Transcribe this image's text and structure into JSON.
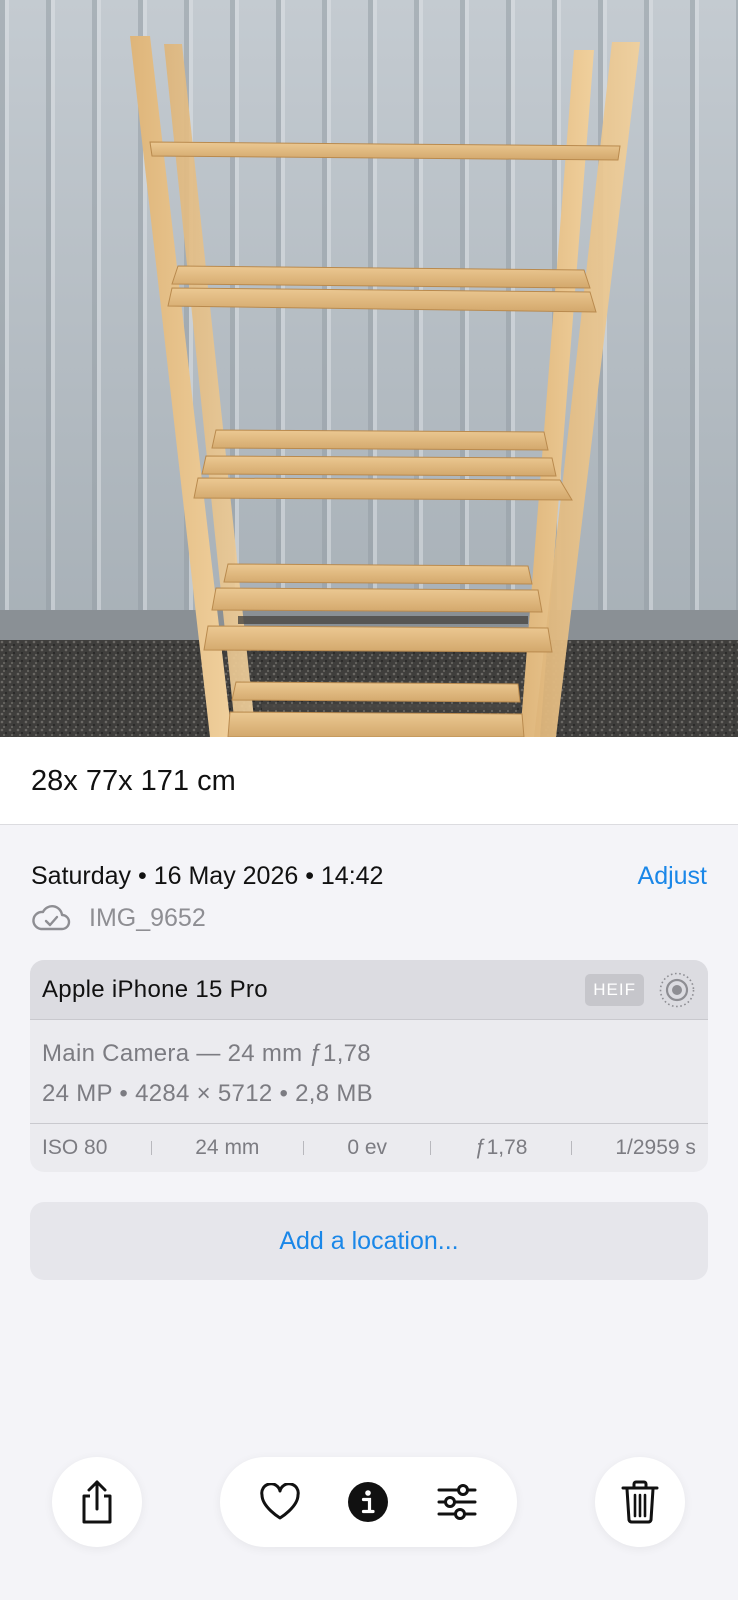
{
  "photo": {
    "subject": "wooden-shelf-photo"
  },
  "caption": "28x 77x 171 cm",
  "info": {
    "date": "Saturday • 16 May 2026 • 14:42",
    "adjust_label": "Adjust",
    "file_name": "IMG_9652",
    "cloud_icon": "cloud-check-icon"
  },
  "camera": {
    "device": "Apple iPhone 15 Pro",
    "format_badge": "HEIF",
    "lens": "Main Camera — 24 mm ƒ1,78",
    "details": "24 MP • 4284 × 5712 • 2,8 MB",
    "exif": [
      "ISO 80",
      "24 mm",
      "0 ev",
      "ƒ1,78",
      "1/2959 s"
    ]
  },
  "location": {
    "label": "Add a location..."
  },
  "toolbar": {
    "share": "share-icon",
    "favorite": "heart-icon",
    "info": "info-icon",
    "edit": "sliders-icon",
    "delete": "trash-icon"
  },
  "colors": {
    "accent": "#1a87e8",
    "background": "#f4f4f8"
  }
}
